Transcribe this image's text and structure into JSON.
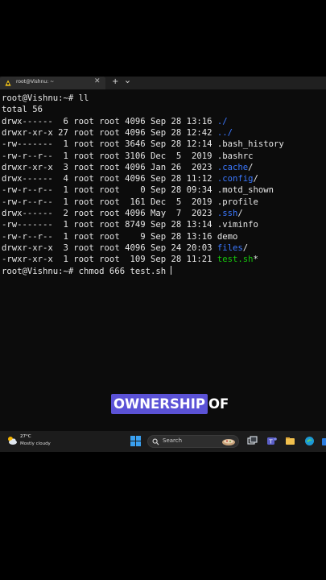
{
  "tab": {
    "title": "root@Vishnu: ~",
    "close_label": "✕",
    "new_tab_label": "+"
  },
  "terminal": {
    "lines": [
      {
        "text": "root@Vishnu:~# ll"
      },
      {
        "text": "total 56"
      },
      {
        "prefix": "drwx------  6 root root 4096 Sep 28 13:16 ",
        "name": "./",
        "color": "blue"
      },
      {
        "prefix": "drwxr-xr-x 27 root root 4096 Sep 28 12:42 ",
        "name": "../",
        "color": "blue"
      },
      {
        "prefix": "-rw-------  1 root root 3646 Sep 28 12:14 ",
        "name": ".bash_history",
        "color": "plain"
      },
      {
        "prefix": "-rw-r--r--  1 root root 3106 Dec  5  2019 ",
        "name": ".bashrc",
        "color": "plain"
      },
      {
        "prefix": "drwxr-xr-x  3 root root 4096 Jan 26  2023 ",
        "name": ".cache",
        "suffix": "/",
        "color": "blue"
      },
      {
        "prefix": "drwx------  4 root root 4096 Sep 28 11:12 ",
        "name": ".config",
        "suffix": "/",
        "color": "blue"
      },
      {
        "prefix": "-rw-r--r--  1 root root    0 Sep 28 09:34 ",
        "name": ".motd_shown",
        "color": "plain"
      },
      {
        "prefix": "-rw-r--r--  1 root root  161 Dec  5  2019 ",
        "name": ".profile",
        "color": "plain"
      },
      {
        "prefix": "drwx------  2 root root 4096 May  7  2023 ",
        "name": ".ssh",
        "suffix": "/",
        "color": "blue"
      },
      {
        "prefix": "-rw-------  1 root root 8749 Sep 28 13:14 ",
        "name": ".viminfo",
        "color": "plain"
      },
      {
        "prefix": "-rw-r--r--  1 root root    9 Sep 28 13:16 ",
        "name": "demo",
        "color": "plain"
      },
      {
        "prefix": "drwxr-xr-x  3 root root 4096 Sep 24 20:03 ",
        "name": "files",
        "suffix": "/",
        "color": "blue"
      },
      {
        "prefix": "-rwxr-xr-x  1 root root  109 Sep 28 11:21 ",
        "name": "test.sh",
        "suffix": "*",
        "color": "green"
      },
      {
        "text": "root@Vishnu:~# chmod 666 test.sh ",
        "cursor": true
      }
    ]
  },
  "caption": {
    "highlight": "OWNERSHIP",
    "rest": "OF",
    "highlight_color": "#5b52d6"
  },
  "taskbar": {
    "weather_temp": "27°C",
    "weather_desc": "Mostly cloudy",
    "search_label": "Search",
    "icons": [
      "windows-start-icon",
      "task-view-icon",
      "teams-icon",
      "file-explorer-icon",
      "edge-icon",
      "store-icon"
    ]
  },
  "colors": {
    "terminal_bg": "#0c0c0c",
    "dir_blue": "#3b78ff",
    "exec_green": "#16c60c"
  }
}
